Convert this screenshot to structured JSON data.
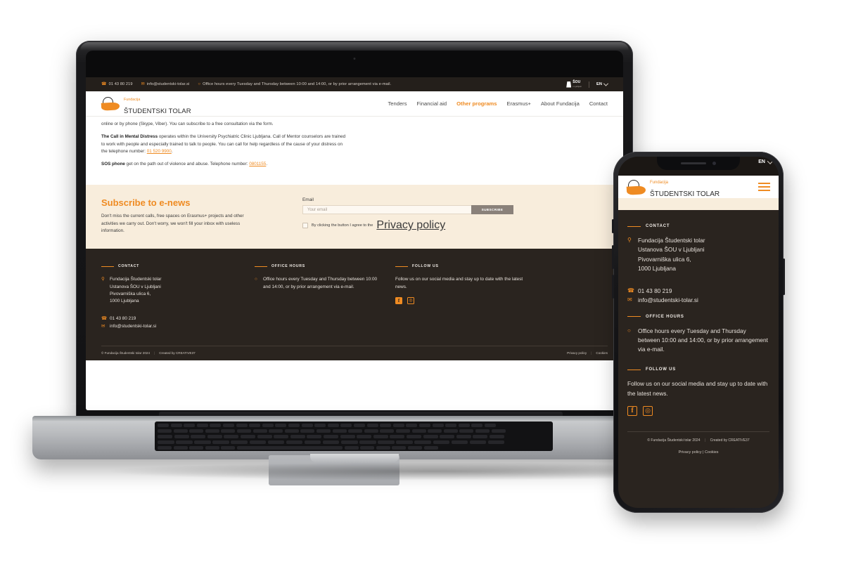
{
  "topbar": {
    "phone": "01 43 80 219",
    "email": "info@studentski-tolar.si",
    "hours": "Office hours every Tuesday and Thursday between 10:00 and 14:00, or by prior arrangement via e-mail.",
    "partner_name": "ŠOU",
    "partner_sub": "v Ljubljani",
    "lang": "EN"
  },
  "brand": {
    "line1": "Fundacija",
    "line2": "ŠTUDENTSKI TOLAR"
  },
  "nav": {
    "items": [
      {
        "label": "Tenders",
        "active": false
      },
      {
        "label": "Financial aid",
        "active": false
      },
      {
        "label": "Other programs",
        "active": true
      },
      {
        "label": "Erasmus+",
        "active": false
      },
      {
        "label": "About Fundacija",
        "active": false
      },
      {
        "label": "Contact",
        "active": false
      }
    ]
  },
  "article": {
    "p1": "online or by phone (Skype, Viber). You can subscribe to a free consultation via the form.",
    "p2_bold": "The Call in Mental Distress",
    "p2_rest": " operates within the University Psychiatric Clinic Ljubljana. Call of Mentor counselors are trained to work with people and especially trained to talk to people. You can call for help regardless of the cause of your distress on the telephone number: ",
    "p2_link": "01 520 9900",
    "p2_end": ".",
    "p3_bold": "SOS phone",
    "p3_rest": " get on the path out of violence and abuse. Telephone number: ",
    "p3_link": "0801155",
    "p3_end": "."
  },
  "newsletter": {
    "title": "Subscribe to e-news",
    "description": "Don't miss the current calls, free spaces on Erasmus+ projects and other activities we carry out. Don't worry, we won't fill your inbox with useless information.",
    "email_label": "Email",
    "email_placeholder": "Your email",
    "email_value": "",
    "button": "SUBSCRIBE",
    "consent_text": "By clicking the button I agree to the ",
    "consent_link": "Privacy policy",
    "checked": false
  },
  "footer": {
    "contact": {
      "heading": "CONTACT",
      "org_lines": [
        "Fundacija Študentski tolar",
        "Ustanova ŠOU v Ljubljani",
        "Pivovarniška ulica 6,",
        "1000 Ljubljana"
      ],
      "phone": "01 43 80 219",
      "email": "info@studentski-tolar.si"
    },
    "office_hours": {
      "heading": "OFFICE HOURS",
      "text": "Office hours every Tuesday and Thursday between 10:00 and 14:00, or by prior arrangement via e-mail."
    },
    "follow": {
      "heading": "FOLLOW US",
      "text": "Follow us on our social media and stay up to date with the latest news.",
      "facebook": "f",
      "instagram": "◎"
    },
    "bottom": {
      "copyright": "© Fundacija Študentski tolar 2024",
      "credit": "Created by CREATIVE37",
      "privacy": "Privacy policy",
      "cookies": "Cookies"
    }
  },
  "colors": {
    "accent": "#ef8b22",
    "dark": "#2a241f",
    "cream": "#f8eddc"
  }
}
